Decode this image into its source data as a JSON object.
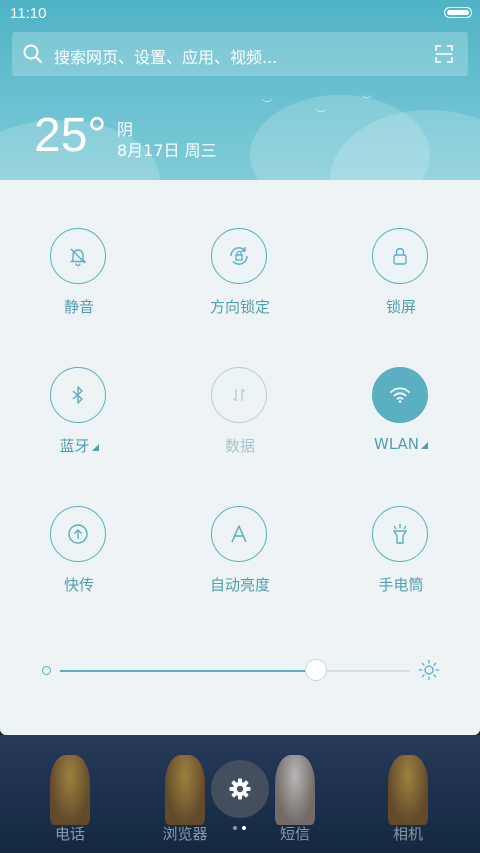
{
  "status": {
    "time": "11:10"
  },
  "search": {
    "placeholder": "搜索网页、设置、应用、视频..."
  },
  "weather": {
    "temperature": "25°",
    "condition": "阴",
    "date": "8月17日 周三"
  },
  "toggles": [
    {
      "label": "静音",
      "icon": "bell-off-icon",
      "state": "off"
    },
    {
      "label": "方向锁定",
      "icon": "rotation-lock-icon",
      "state": "off"
    },
    {
      "label": "锁屏",
      "icon": "lock-icon",
      "state": "off"
    },
    {
      "label": "蓝牙",
      "icon": "bluetooth-icon",
      "state": "off",
      "has_menu": true
    },
    {
      "label": "数据",
      "icon": "mobile-data-icon",
      "state": "disabled"
    },
    {
      "label": "WLAN",
      "icon": "wifi-icon",
      "state": "on",
      "has_menu": true
    },
    {
      "label": "快传",
      "icon": "transfer-icon",
      "state": "off"
    },
    {
      "label": "自动亮度",
      "icon": "auto-brightness-icon",
      "state": "off"
    },
    {
      "label": "手电筒",
      "icon": "flashlight-icon",
      "state": "off"
    }
  ],
  "brightness": {
    "value": 0.73
  },
  "dock": {
    "apps": [
      "电话",
      "浏览器",
      "短信",
      "相机"
    ]
  },
  "colors": {
    "accent": "#5aafc1",
    "panel": "#eef3f5",
    "header": "#6cc0d0"
  }
}
